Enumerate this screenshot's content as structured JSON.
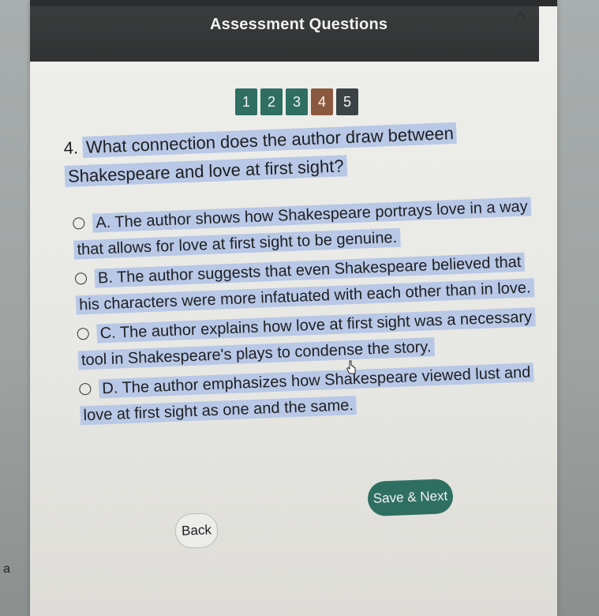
{
  "header": {
    "title": "Assessment Questions",
    "collapse_icon": "chevron-up-icon"
  },
  "pager": {
    "pages": [
      "1",
      "2",
      "3",
      "4",
      "5"
    ],
    "current": "4"
  },
  "question": {
    "number": "4.",
    "text": "What connection does the author draw between Shakespeare and love at first sight?"
  },
  "options": [
    {
      "label": "A. The author shows how Shakespeare portrays love in a way that allows for love at first sight to be genuine."
    },
    {
      "label": "B. The author suggests that even Shakespeare believed that his characters were more infatuated with each other than in love."
    },
    {
      "label": "C. The author explains how love at first sight was a necessary tool in Shakespeare's plays to condense the story."
    },
    {
      "label": "D. The author emphasizes how Shakespeare viewed lust and love at first sight as one and the same."
    }
  ],
  "actions": {
    "save_label": "Save & Next",
    "back_label": "Back"
  },
  "outside_text": "a",
  "colors": {
    "header_bg": "#333536",
    "accent": "#2f6f62",
    "active_page": "#8b5a3e",
    "highlight": "#b8c8e6"
  }
}
